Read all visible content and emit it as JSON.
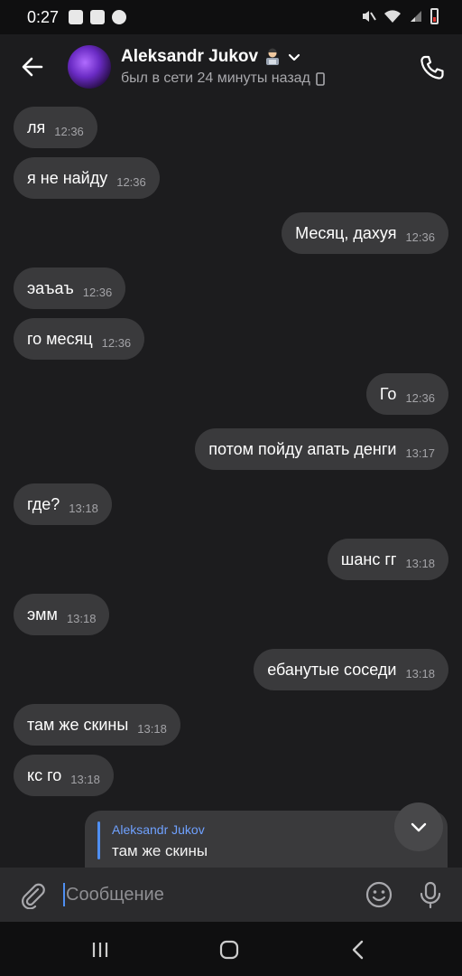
{
  "status_bar": {
    "time": "0:27"
  },
  "header": {
    "contact_name": "Aleksandr Jukov",
    "status": "был в сети 24 минуты назад"
  },
  "messages": [
    {
      "text": "ля",
      "time": "12:36",
      "side": "in"
    },
    {
      "text": "я не найду",
      "time": "12:36",
      "side": "in"
    },
    {
      "text": "Месяц, дахуя",
      "time": "12:36",
      "side": "out"
    },
    {
      "text": "эаъаъ",
      "time": "12:36",
      "side": "in"
    },
    {
      "text": "го месяц",
      "time": "12:36",
      "side": "in"
    },
    {
      "text": "Го",
      "time": "12:36",
      "side": "out"
    },
    {
      "text": "потом пойду апать денги",
      "time": "13:17",
      "side": "out"
    },
    {
      "text": "где?",
      "time": "13:18",
      "side": "in"
    },
    {
      "text": "шанс гг",
      "time": "13:18",
      "side": "out"
    },
    {
      "text": "эмм",
      "time": "13:18",
      "side": "in"
    },
    {
      "text": "ебанутые соседи",
      "time": "13:18",
      "side": "out"
    },
    {
      "text": "там же скины",
      "time": "13:18",
      "side": "in"
    },
    {
      "text": "кс го",
      "time": "13:18",
      "side": "in"
    }
  ],
  "reply": {
    "author": "Aleksandr Jukov",
    "text": "там же скины"
  },
  "composer": {
    "placeholder": "Сообщение"
  },
  "colors": {
    "accent": "#4f8ff2",
    "bubble": "#3a3a3c",
    "background": "#1c1c1e"
  }
}
